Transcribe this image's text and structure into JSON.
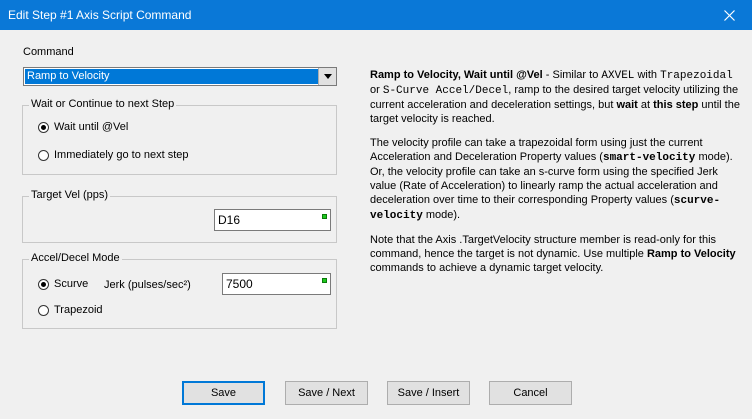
{
  "window": {
    "title": "Edit Step #1 Axis Script Command"
  },
  "command": {
    "label": "Command",
    "selected": "Ramp to Velocity"
  },
  "wait_group": {
    "legend": "Wait or Continue to next Step",
    "options": [
      "Wait until @Vel",
      "Immediately go to next step"
    ],
    "selected_index": 0
  },
  "target_group": {
    "legend": "Target Vel (pps)",
    "value": "D16"
  },
  "accel_group": {
    "legend": "Accel/Decel Mode",
    "options": [
      "Scurve",
      "Trapezoid"
    ],
    "selected_index": 0,
    "jerk_label": "Jerk (pulses/sec²)",
    "jerk_value": "7500"
  },
  "help": {
    "p1": {
      "t1": "Ramp to Velocity, Wait until @Vel",
      "t2": " - Similar to ",
      "t3": "AXVEL",
      "t4": " with ",
      "t5": "Trapezoidal",
      "t6": " or ",
      "t7": "S-Curve Accel/Decel",
      "t8": ", ramp to the desired target velocity utilizing the current acceleration and deceleration settings, but ",
      "t9": "wait",
      "t10": " at ",
      "t11": "this step",
      "t12": " until the target velocity is reached."
    },
    "p2": {
      "t1": "The velocity profile can take a trapezoidal form using just the current Acceleration and Deceleration Property values (",
      "t2": "smart-velocity",
      "t3": " mode). Or, the velocity profile can take an s-curve form using the specified Jerk value (Rate of Acceleration) to linearly ramp the actual acceleration and deceleration over time to their corresponding Property values (",
      "t4": "scurve-velocity",
      "t5": " mode)."
    },
    "p3": {
      "t1": "Note that the Axis .TargetVelocity structure member is read-only for this command, hence the target is not dynamic. Use multiple ",
      "t2": "Ramp to Velocity",
      "t3": " commands to achieve a dynamic target velocity."
    }
  },
  "buttons": {
    "save": "Save",
    "save_next": "Save / Next",
    "save_insert": "Save / Insert",
    "cancel": "Cancel"
  },
  "colors": {
    "titlebar": "#0a78d7",
    "selection": "#0078d7",
    "status_dot": "#1ec81e"
  }
}
